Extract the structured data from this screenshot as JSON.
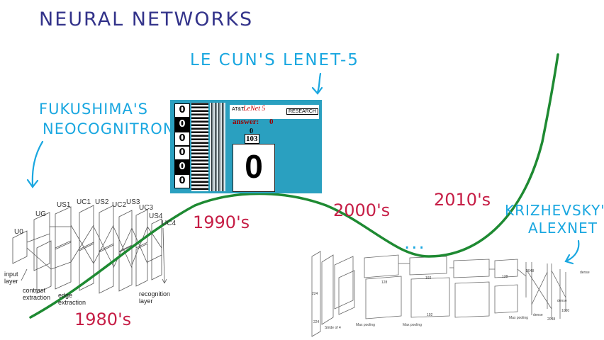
{
  "title": "NEURAL NETWORKS",
  "annotations": {
    "lenet": "LE CUN'S LENET-5",
    "neocognitron_line1": "FUKUSHIMA'S",
    "neocognitron_line2": "NEOCOGNITRON",
    "alexnet_line1": "KRIZHEVSKY'S",
    "alexnet_line2": "ALEXNET",
    "ellipsis": "..."
  },
  "eras": [
    "1980's",
    "1990's",
    "2000's",
    "2010's"
  ],
  "neocognitron": {
    "layers": [
      "U0",
      "UG",
      "US1",
      "UC1",
      "US2",
      "UC2",
      "US3",
      "UC3",
      "US4",
      "UC4"
    ],
    "labels": [
      "input layer",
      "contrast extraction",
      "edge extraction",
      "recognition layer"
    ]
  },
  "lenet_panel": {
    "brand": "AT&T",
    "name": "LeNet 5",
    "research": "RESEARCH",
    "answer_label": "answer:",
    "answer_value": "0",
    "counter_top": "0",
    "counter_bottom": "103",
    "digit": "0",
    "thumb_digits": [
      "0",
      "0",
      "0",
      "0",
      "0",
      "0"
    ]
  },
  "alexnet": {
    "labels": [
      "224",
      "224",
      "Stride of 4",
      "Max pooling",
      "Max pooling",
      "Max pooling",
      "dense",
      "dense",
      "dense",
      "128",
      "192",
      "192",
      "128",
      "2048",
      "2048",
      "1000"
    ]
  },
  "colors": {
    "curve": "#1e8a32",
    "era": "#c61e46",
    "annotation": "#1aa7e0",
    "title": "#33338a",
    "panel": "#2aa0c0"
  }
}
